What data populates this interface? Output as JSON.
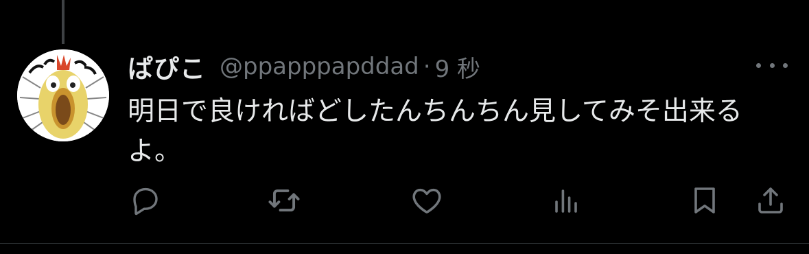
{
  "tweet": {
    "display_name": "ぱぴこ",
    "handle": "@ppapppapddad",
    "separator": "·",
    "time": "9 秒",
    "text": "明日で良ければどしたんちんちん見してみそ出来るよ。"
  },
  "icons": {
    "more": "more-icon",
    "reply": "reply-icon",
    "retweet": "retweet-icon",
    "like": "heart-icon",
    "views": "analytics-icon",
    "bookmark": "bookmark-icon",
    "share": "share-icon"
  },
  "colors": {
    "background": "#000000",
    "text_primary": "#e7e9ea",
    "text_secondary": "#71767b",
    "divider": "#2f3336"
  }
}
